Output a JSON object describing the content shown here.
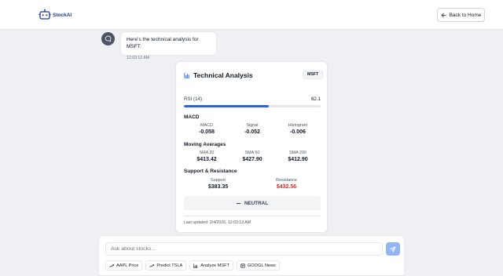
{
  "header": {
    "logo_text": "StockAI",
    "back_label": "Back to Home",
    "icons": {
      "logo": "bot-logo-icon",
      "back": "arrow-left-icon"
    }
  },
  "message": {
    "text": "Here's the technical analysis for MSFT:",
    "time": "12:03:12 AM",
    "avatar_icon": "chat-bubble-icon"
  },
  "analysis": {
    "title": "Technical Analysis",
    "ticker": "MSFT",
    "rsi": {
      "label": "RSI (14)",
      "value": "62.1",
      "fill_percent": 62.1
    },
    "macd": {
      "title": "MACD",
      "items": [
        {
          "label": "MACD",
          "value": "-0.058"
        },
        {
          "label": "Signal",
          "value": "-0.052"
        },
        {
          "label": "Histogram",
          "value": "-0.006"
        }
      ]
    },
    "moving_averages": {
      "title": "Moving Averages",
      "items": [
        {
          "label": "SMA 20",
          "value": "$413.42"
        },
        {
          "label": "SMA 50",
          "value": "$427.90"
        },
        {
          "label": "SMA 200",
          "value": "$412.90"
        }
      ]
    },
    "support_resistance": {
      "title": "Support & Resistance",
      "support_label": "Support",
      "support_value": "$383.35",
      "resistance_label": "Resistance",
      "resistance_value": "$432.56"
    },
    "signal": "NEUTRAL",
    "updated": "Last updated: 2/4/2026, 12:03:13 AM"
  },
  "composer": {
    "placeholder": "Ask about stocks...",
    "chips": [
      {
        "label": "AAPL Price",
        "icon": "trending-up-icon"
      },
      {
        "label": "Predict TSLA",
        "icon": "trending-up-icon"
      },
      {
        "label": "Analyze MSFT",
        "icon": "bar-chart-icon"
      },
      {
        "label": "GOOGL News",
        "icon": "newspaper-icon"
      }
    ]
  },
  "colors": {
    "accent": "#2563eb",
    "resistance": "#dc2626",
    "send_button": "#93b4f5",
    "background": "#eef0f4"
  }
}
